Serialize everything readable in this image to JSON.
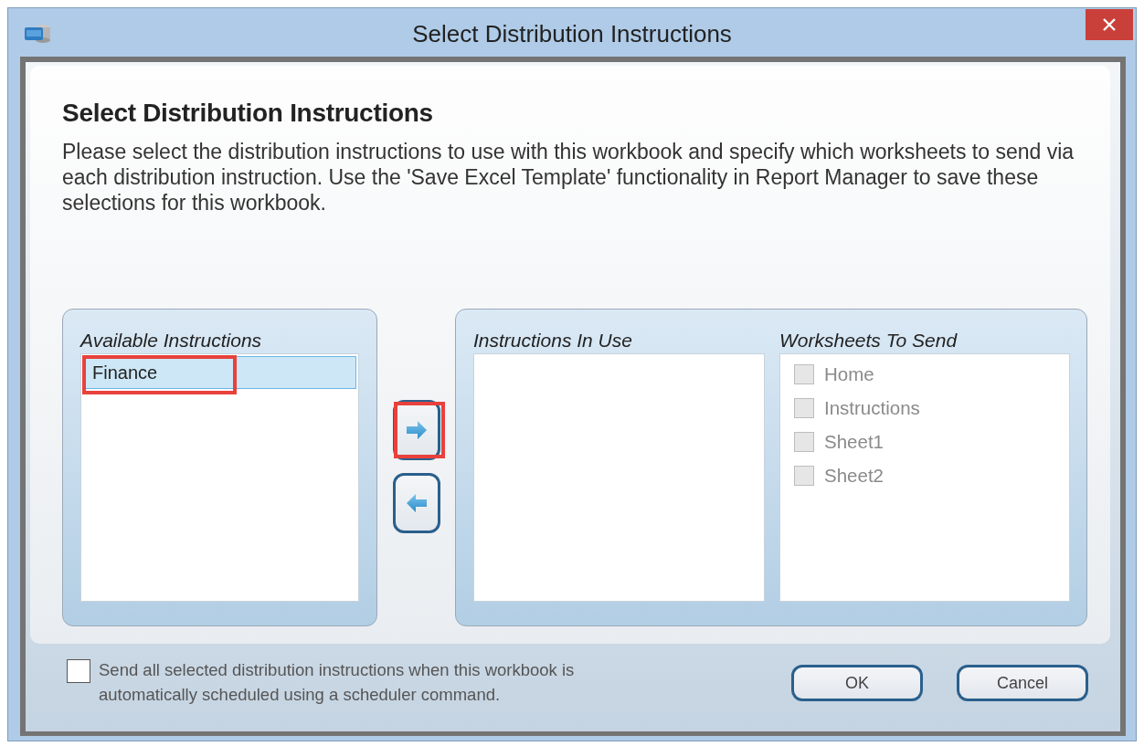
{
  "window": {
    "title": "Select Distribution Instructions"
  },
  "heading": "Select Distribution Instructions",
  "description": "Please select the distribution instructions to use with this workbook and specify which worksheets to send via each distribution instruction. Use the 'Save Excel Template' functionality in Report Manager to save these selections for this workbook.",
  "available": {
    "label": "Available Instructions",
    "items": [
      {
        "text": "Finance",
        "selected": true,
        "highlighted": true
      }
    ]
  },
  "move_buttons": [
    {
      "kind": "right",
      "highlighted": true
    },
    {
      "kind": "left",
      "highlighted": false
    }
  ],
  "in_use": {
    "label": "Instructions In Use"
  },
  "worksheets": {
    "label": "Worksheets To Send",
    "items": [
      {
        "text": "Home",
        "checked": false,
        "disabled": true
      },
      {
        "text": "Instructions",
        "checked": false,
        "disabled": true
      },
      {
        "text": "Sheet1",
        "checked": false,
        "disabled": true
      },
      {
        "text": "Sheet2",
        "checked": false,
        "disabled": true
      }
    ]
  },
  "auto_send": {
    "label": "Send all selected distribution instructions when this workbook is automatically scheduled using a scheduler command.",
    "checked": false
  },
  "buttons": [
    {
      "label": "OK"
    },
    {
      "label": "Cancel"
    }
  ]
}
